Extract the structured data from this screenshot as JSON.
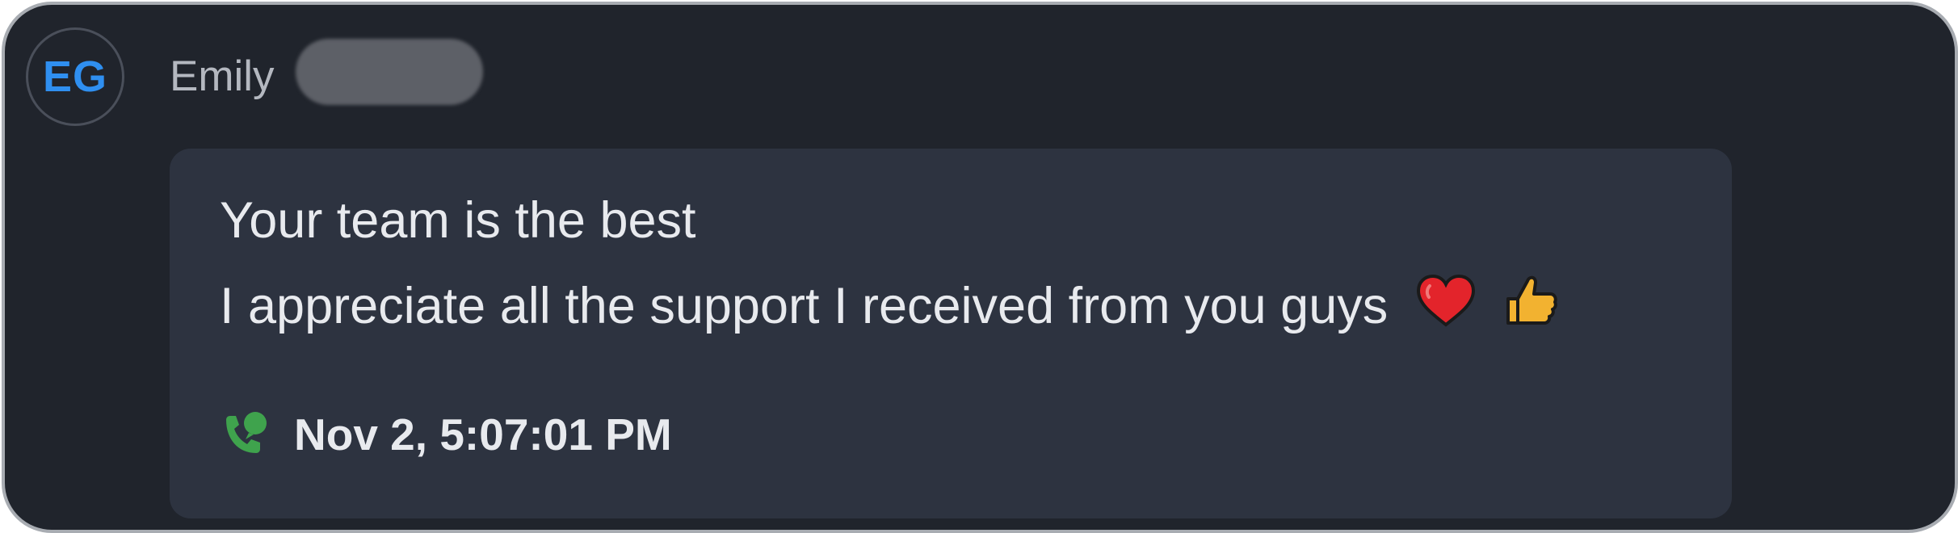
{
  "message": {
    "avatar_initials": "EG",
    "sender_first_name": "Emily",
    "lines": [
      "Your team is the best",
      "I appreciate all the support I received from you guys"
    ],
    "emojis": [
      "heart-icon",
      "thumbs-up-icon"
    ],
    "channel_icon": "phone-chat-icon",
    "timestamp": "Nov 2, 5:07:01 PM"
  },
  "colors": {
    "background": "#20242c",
    "bubble": "#2d3340",
    "avatar_text": "#2f8ff0",
    "channel_icon": "#3fa34d"
  }
}
